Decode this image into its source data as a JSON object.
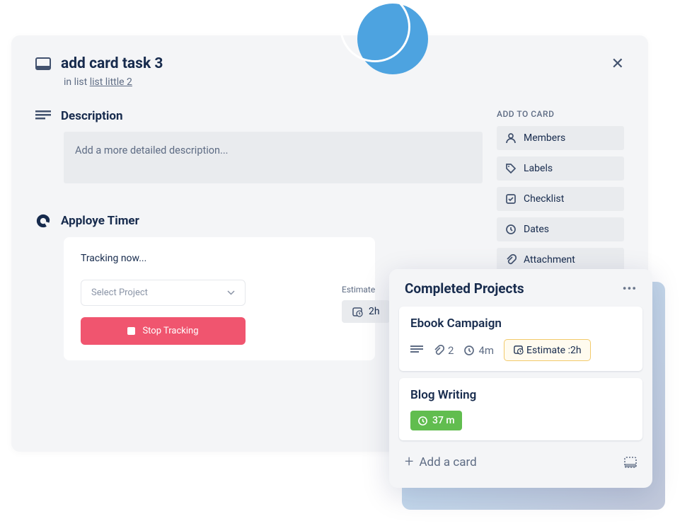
{
  "card": {
    "title": "add card task 3",
    "sublist_prefix": "in list ",
    "sublist_link": "list little 2"
  },
  "description": {
    "heading": "Description",
    "placeholder": "Add a more detailed description..."
  },
  "apploye": {
    "heading": "Apploye Timer",
    "tracking_label": "Tracking now...",
    "select_placeholder": "Select Project",
    "stop_label": "Stop Tracking"
  },
  "estimate": {
    "label": "Estimate",
    "value": "2h"
  },
  "sidebar": {
    "heading": "ADD TO CARD",
    "items": [
      "Members",
      "Labels",
      "Checklist",
      "Dates",
      "Attachment"
    ]
  },
  "column": {
    "title": "Completed Projects",
    "cards": [
      {
        "title": "Ebook Campaign",
        "attachments": "2",
        "tracked": "4m",
        "estimate_label": "Estimate :2h"
      },
      {
        "title": "Blog Writing",
        "tracked": "37 m"
      }
    ],
    "add_card": "Add a card"
  }
}
